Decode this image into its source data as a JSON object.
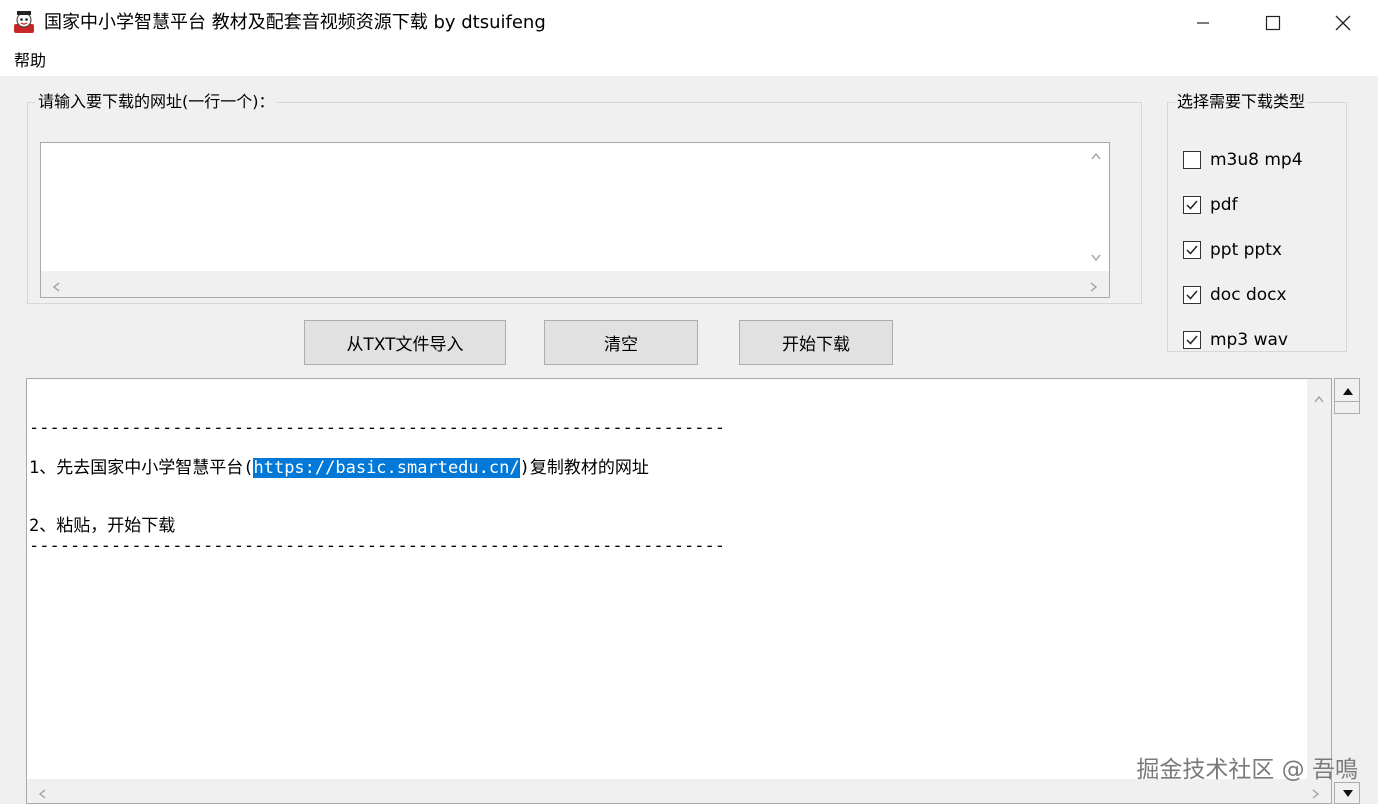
{
  "window": {
    "title": "国家中小学智慧平台 教材及配套音视频资源下载 by dtsuifeng",
    "icon": "app-icon"
  },
  "menu": {
    "help": "帮助"
  },
  "url_group": {
    "legend": "请输入要下载的网址(一行一个)：",
    "value": ""
  },
  "type_group": {
    "legend": "选择需要下载类型",
    "options": [
      {
        "label": "m3u8 mp4",
        "checked": false
      },
      {
        "label": "pdf",
        "checked": true
      },
      {
        "label": "ppt pptx",
        "checked": true
      },
      {
        "label": "doc docx",
        "checked": true
      },
      {
        "label": "mp3 wav",
        "checked": true
      }
    ]
  },
  "buttons": {
    "import_txt": "从TXT文件导入",
    "clear": "清空",
    "start_download": "开始下载"
  },
  "log": {
    "divider": "--------------------------------------------------------------------",
    "line1_prefix": "1、先去国家中小学智慧平台(",
    "line1_url": "https://basic.smartedu.cn/",
    "line1_suffix": ")复制教材的网址",
    "line2": "2、粘贴，开始下载"
  },
  "watermark": "掘金技术社区 @ 吾鳴",
  "colors": {
    "selection": "#0078d7",
    "button_bg": "#e1e1e1",
    "window_bg": "#f0f0f0"
  }
}
